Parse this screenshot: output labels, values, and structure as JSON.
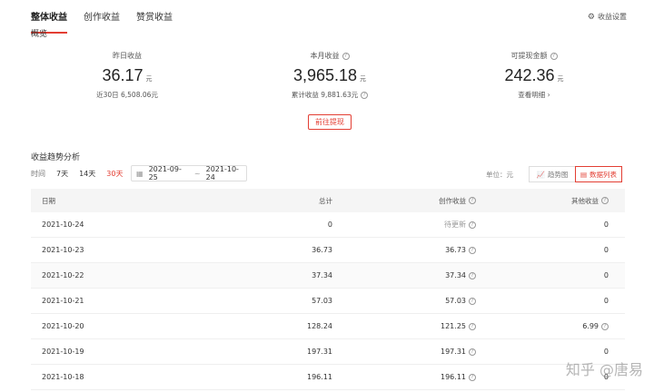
{
  "tabs": [
    {
      "label": "整体收益",
      "active": true
    },
    {
      "label": "创作收益",
      "active": false
    },
    {
      "label": "赞赏收益",
      "active": false
    }
  ],
  "settings_label": "收益设置",
  "overview_title": "概览",
  "stats": {
    "yesterday": {
      "label": "昨日收益",
      "value": "36.17",
      "unit": "元",
      "sub": "近30日 6,508.06元"
    },
    "month": {
      "label": "本月收益",
      "value": "3,965.18",
      "unit": "元",
      "sub": "累计收益 9,881.63元"
    },
    "withdrawable": {
      "label": "可提现金额",
      "value": "242.36",
      "unit": "元",
      "sub": "查看明细 ›"
    }
  },
  "withdraw_button": "前往提现",
  "trend_title": "收益趋势分析",
  "filters": {
    "label": "时间",
    "ranges": [
      {
        "label": "7天",
        "active": false
      },
      {
        "label": "14天",
        "active": false
      },
      {
        "label": "30天",
        "active": true
      }
    ],
    "date_start": "2021-09-25",
    "date_sep": "~",
    "date_end": "2021-10-24"
  },
  "unit_label": "单位：元",
  "views": {
    "trend": "趋势图",
    "list": "数据列表"
  },
  "table": {
    "headers": {
      "date": "日期",
      "total": "总计",
      "creation": "创作收益",
      "other": "其他收益"
    },
    "rows": [
      {
        "date": "2021-10-24",
        "total": "0",
        "creation": "待更新",
        "other": "0"
      },
      {
        "date": "2021-10-23",
        "total": "36.73",
        "creation": "36.73",
        "other": "0"
      },
      {
        "date": "2021-10-22",
        "total": "37.34",
        "creation": "37.34",
        "other": "0"
      },
      {
        "date": "2021-10-21",
        "total": "57.03",
        "creation": "57.03",
        "other": "0"
      },
      {
        "date": "2021-10-20",
        "total": "128.24",
        "creation": "121.25",
        "other": "6.99"
      },
      {
        "date": "2021-10-19",
        "total": "197.31",
        "creation": "197.31",
        "other": "0"
      },
      {
        "date": "2021-10-18",
        "total": "196.11",
        "creation": "196.11",
        "other": "0"
      }
    ]
  },
  "watermark": "知乎 @唐易",
  "colors": {
    "accent": "#e33e33"
  }
}
